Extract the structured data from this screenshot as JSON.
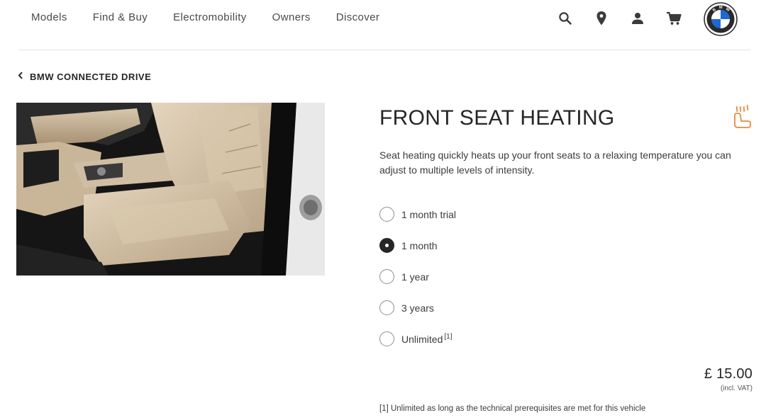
{
  "nav": {
    "links": [
      "Models",
      "Find & Buy",
      "Electromobility",
      "Owners",
      "Discover"
    ],
    "icons": [
      "search-icon",
      "location-pin-icon",
      "user-icon",
      "cart-icon"
    ],
    "logo": "bmw-logo"
  },
  "breadcrumb": {
    "label": "BMW CONNECTED DRIVE"
  },
  "product": {
    "image": "front-seat-interior-photo",
    "title": "FRONT SEAT HEATING",
    "icon": "seat-heating-icon",
    "description": "Seat heating quickly heats up your front seats to a relaxing temperature you can adjust to multiple levels of intensity.",
    "options": [
      {
        "label": "1 month trial",
        "selected": false,
        "footnote": ""
      },
      {
        "label": "1 month",
        "selected": true,
        "footnote": ""
      },
      {
        "label": "1 year",
        "selected": false,
        "footnote": ""
      },
      {
        "label": "3 years",
        "selected": false,
        "footnote": ""
      },
      {
        "label": "Unlimited",
        "selected": false,
        "footnote": "[1]"
      }
    ],
    "price": "£ 15.00",
    "vat_note": "(incl. VAT)",
    "footnote": "[1] Unlimited as long as the technical prerequisites are met for this vehicle"
  },
  "colors": {
    "accent_orange": "#e8893f",
    "bmw_blue": "#1c69d4",
    "text": "#262626"
  }
}
